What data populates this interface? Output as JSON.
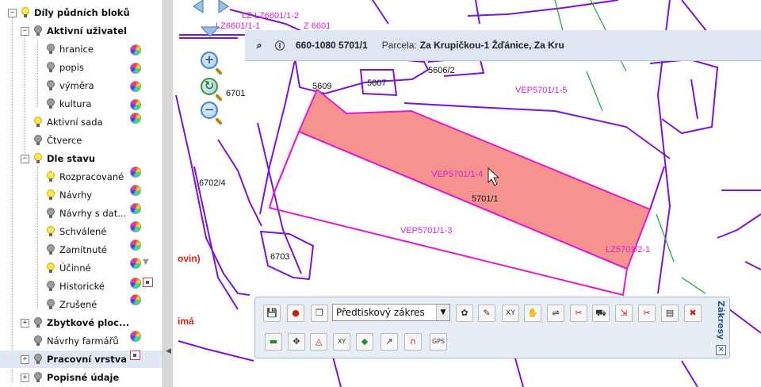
{
  "tree": {
    "root": {
      "label": "Díly půdních bloků",
      "expand": "−",
      "on": true
    },
    "aktivni_uzivatel": {
      "label": "Aktivní uživatel",
      "expand": "−",
      "on": false
    },
    "hranice": {
      "label": "hranice"
    },
    "popis": {
      "label": "popis"
    },
    "vymera": {
      "label": "výměra"
    },
    "kultura": {
      "label": "kultura"
    },
    "aktivni_sada": {
      "label": "Aktivní sada"
    },
    "ctverce": {
      "label": "Čtverce"
    },
    "dle_stavu": {
      "label": "Dle stavu",
      "expand": "−"
    },
    "rozpracovane": {
      "label": "Rozpracované"
    },
    "navrhy": {
      "label": "Návrhy"
    },
    "navrhy_s_dat": {
      "label": "Návrhy s dat..."
    },
    "schvalene": {
      "label": "Schválené"
    },
    "zamitnute": {
      "label": "Zamítnuté"
    },
    "ucinne": {
      "label": "Účinné"
    },
    "historicke": {
      "label": "Historické"
    },
    "zrusene": {
      "label": "Zrušené"
    },
    "zbytkove": {
      "label": "Zbytkové ploc...",
      "expand": "+"
    },
    "navrhy_farmaru": {
      "label": "Návrhy farmářů"
    },
    "pracovni_vrstva": {
      "label": "Pracovní vrstva",
      "expand": "+"
    },
    "popisne_udaje": {
      "label": "Popisné údaje",
      "expand": "+"
    }
  },
  "infobar": {
    "code": "660-1080 5701/1",
    "parcel_label": "Parcela:",
    "parcel_value": "Za Krupičkou-1 Žďánice, Za Kru"
  },
  "map": {
    "labels": {
      "lz1": "LZ LZ6601/1-2",
      "lz2": "LZ6601/1-1",
      "z6601": "Z 6601",
      "p5609": "5609",
      "p5607": "5607",
      "p5606_2": "5606/2",
      "vep1_5": "VEP5701/1-5",
      "p6701": "6701",
      "vep1_4": "VEP5701/1-4",
      "p5701_1": "5701/1",
      "p6702_4": "6702/4",
      "vep1_3": "VEP5701/1-3",
      "p6703": "6703",
      "lz5701": "LZ5701/2-1",
      "red1": "ovin)",
      "red2": "imá"
    },
    "colors": {
      "boundary": "#7a14d8",
      "label": "#d61fd6",
      "selected_fill": "#f7938e",
      "selected_stroke": "#e21bd1"
    }
  },
  "toolbar": {
    "combo_value": "Předtiskový zákres",
    "title": "Zákresy",
    "close": "✕",
    "icons_row1": [
      "save-icon",
      "stop-icon",
      "windows-icon",
      "settings-icon",
      "draw-line-icon",
      "coords-xy-icon",
      "erase-icon",
      "split-icon",
      "cut-icon",
      "tractor-icon",
      "merge-icon",
      "cut2-icon",
      "layers-icon",
      "delete-cross-icon"
    ],
    "icons_row2": [
      "import-icon",
      "snap-icon",
      "redo-shape-icon",
      "xy-point-icon",
      "polygon-fill-icon",
      "measure-icon",
      "magnet-icon",
      "gps-icon"
    ],
    "glyph_row1": [
      "💾",
      "●",
      "❐",
      "✿",
      "✎",
      "XY",
      "✋",
      "⇌",
      "✂",
      "⛟",
      "⇲",
      "✂",
      "▤",
      "✖"
    ],
    "glyph_row2": [
      "▬",
      "✥",
      "◬",
      "XY",
      "◆",
      "↗",
      "∩",
      "GPS"
    ]
  }
}
